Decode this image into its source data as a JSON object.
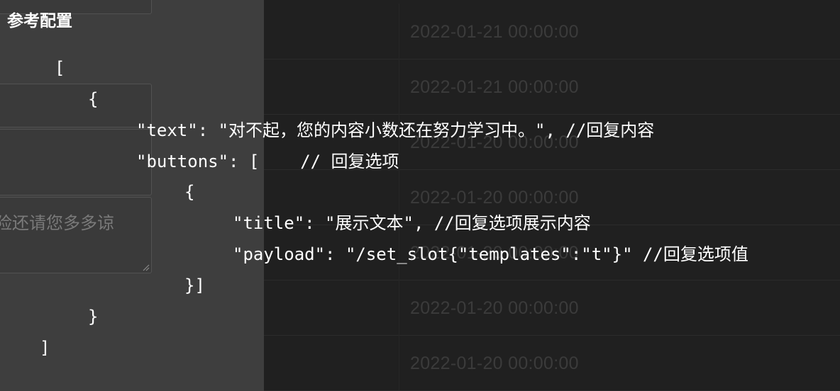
{
  "panel": {
    "title": "参考配置",
    "field_text": "险还请您多多谅"
  },
  "table": {
    "dates": [
      "2022-01-21 00:00:00",
      "2022-01-21 00:00:00",
      "2022-01-20 00:00:00",
      "2022-01-20 00:00:00",
      "2022-01-20 00:00:00",
      "2022-01-20 00:00:00",
      "2022-01-20 00:00:00"
    ]
  },
  "code": {
    "lines": [
      "[",
      "{",
      "\"text\": \"对不起，您的内容小数还在努力学习中。\", //回复内容",
      "\"buttons\": [    // 回复选项",
      "{",
      "\"title\": \"展示文本\", //回复选项展示内容",
      "\"payload\": \"/set_slot{\"templates\":\"t\"}\" //回复选项值",
      "}]",
      "}",
      "]"
    ]
  },
  "colors": {
    "panel_bg": "#3e3e3e",
    "table_bg": "#202020",
    "code_text": "#ffffff"
  }
}
